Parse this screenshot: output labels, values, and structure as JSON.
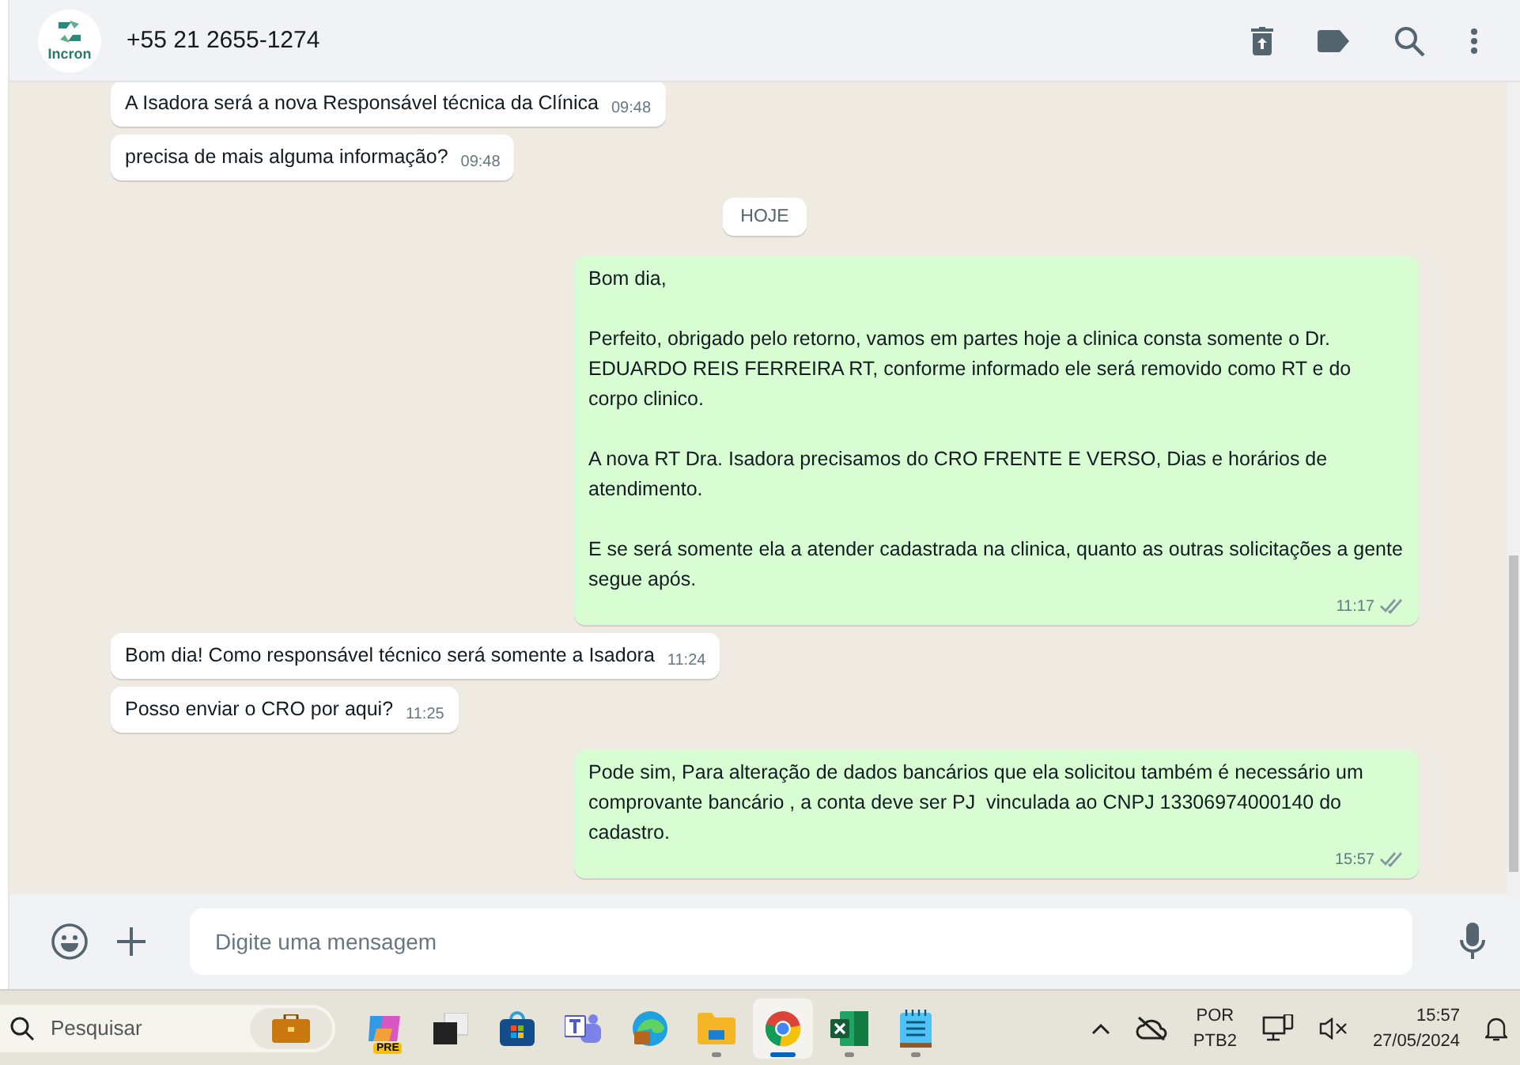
{
  "header": {
    "logo_text": "Incron",
    "title": "+55 21 2655-1274"
  },
  "messages": [
    {
      "kind": "in",
      "text": "A Isadora será a nova Responsável técnica da Clínica",
      "time": "09:48"
    },
    {
      "kind": "in",
      "text": "precisa de mais alguma informação?",
      "time": "09:48"
    },
    {
      "kind": "date",
      "text": "HOJE"
    },
    {
      "kind": "out",
      "text": "Bom dia,\n\nPerfeito, obrigado pelo retorno, vamos em partes hoje a clinica consta somente o Dr. EDUARDO REIS FERREIRA RT, conforme informado ele será removido como RT e do corpo clinico.\n\nA nova RT Dra. Isadora precisamos do CRO FRENTE E VERSO, Dias e horários de atendimento.\n\nE se será somente ela a atender cadastrada na clinica, quanto as outras solicitações a gente segue após.",
      "time": "11:17",
      "read": false
    },
    {
      "kind": "in",
      "text": "Bom dia! Como responsável técnico será somente a Isadora",
      "time": "11:24"
    },
    {
      "kind": "in",
      "text": "Posso enviar o CRO por aqui?",
      "time": "11:25"
    },
    {
      "kind": "out",
      "text": "Pode sim, Para alteração de dados bancários que ela solicitou também é necessário um comprovante bancário , a conta deve ser PJ  vinculada ao CNPJ 13306974000140 do cadastro.",
      "time": "15:57",
      "read": false
    }
  ],
  "composer": {
    "placeholder": "Digite uma mensagem"
  },
  "taskbar": {
    "search_placeholder": "Pesquisar",
    "apps": [
      {
        "kind": "copilot",
        "badge": "PRE",
        "selected": false,
        "running": false
      },
      {
        "kind": "taskview",
        "selected": false,
        "running": false
      },
      {
        "kind": "store",
        "selected": false,
        "running": false
      },
      {
        "kind": "teams",
        "selected": false,
        "running": false
      },
      {
        "kind": "edge",
        "selected": false,
        "running": false
      },
      {
        "kind": "folder",
        "selected": false,
        "running": true
      },
      {
        "kind": "chrome",
        "selected": true,
        "running": true
      },
      {
        "kind": "excel",
        "selected": false,
        "running": true
      },
      {
        "kind": "notepad",
        "selected": false,
        "running": true
      }
    ],
    "language": "POR",
    "layout": "PTB2",
    "time": "15:57",
    "date": "27/05/2024"
  }
}
